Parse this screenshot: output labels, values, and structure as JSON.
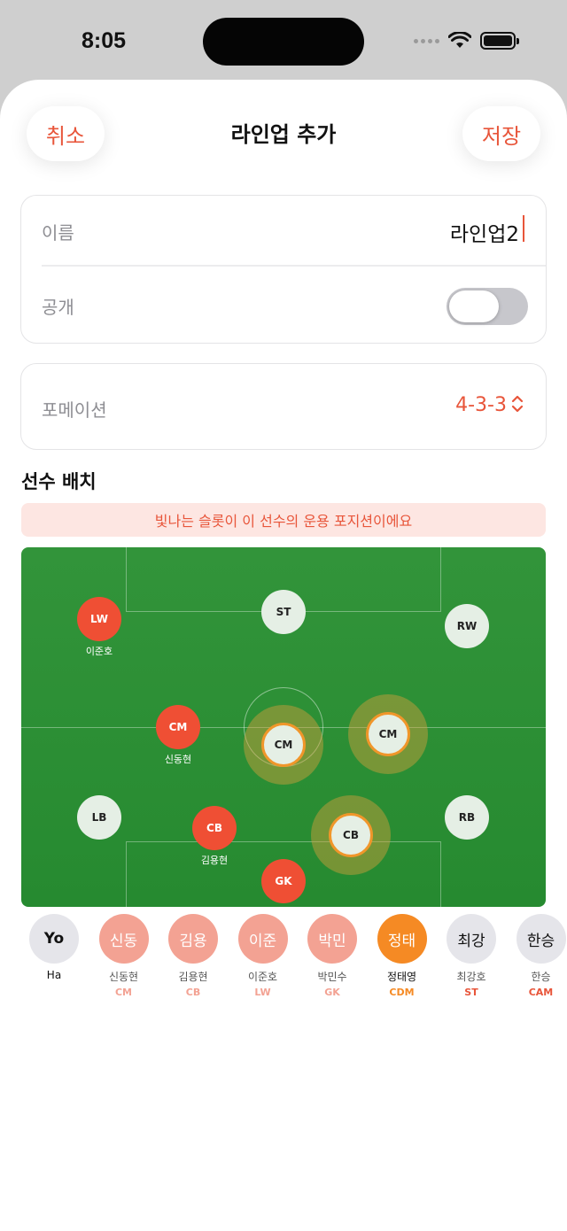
{
  "status": {
    "time": "8:05"
  },
  "nav": {
    "cancel": "취소",
    "title": "라인업 추가",
    "save": "저장"
  },
  "form": {
    "name_label": "이름",
    "name_value": "라인업2",
    "public_label": "공개",
    "public_on": false,
    "formation_label": "포메이션",
    "formation_value": "4-3-3"
  },
  "section": {
    "title": "선수 배치",
    "hint": "빛나는 슬롯이 이 선수의 운용 포지션이에요"
  },
  "pitch": {
    "slots": [
      {
        "pos": "ST",
        "state": "empty"
      },
      {
        "pos": "LW",
        "state": "filled",
        "player": "이준호"
      },
      {
        "pos": "RW",
        "state": "empty"
      },
      {
        "pos": "CM",
        "state": "filled",
        "player": "신동현"
      },
      {
        "pos": "CM",
        "state": "highlighted"
      },
      {
        "pos": "CM",
        "state": "highlighted"
      },
      {
        "pos": "LB",
        "state": "empty"
      },
      {
        "pos": "CB",
        "state": "filled",
        "player": "김용현"
      },
      {
        "pos": "CB",
        "state": "highlighted"
      },
      {
        "pos": "RB",
        "state": "empty"
      },
      {
        "pos": "GK",
        "state": "filled"
      }
    ]
  },
  "bench": [
    {
      "initials": "Yo",
      "name": "Ha",
      "pos": ""
    },
    {
      "initials": "신동",
      "name": "신동현",
      "pos": "CM"
    },
    {
      "initials": "김용",
      "name": "김용현",
      "pos": "CB"
    },
    {
      "initials": "이준",
      "name": "이준호",
      "pos": "LW"
    },
    {
      "initials": "박민",
      "name": "박민수",
      "pos": "GK"
    },
    {
      "initials": "정태",
      "name": "정태영",
      "pos": "CDM"
    },
    {
      "initials": "최강",
      "name": "최강호",
      "pos": "ST"
    },
    {
      "initials": "한승",
      "name": "한승",
      "pos": "CAM"
    }
  ],
  "colors": {
    "accent": "#e8553a",
    "pitch": "#2e8f36",
    "highlight": "#f0962a",
    "assigned_bench": "#f3a293",
    "selected_bench": "#f58a24"
  }
}
